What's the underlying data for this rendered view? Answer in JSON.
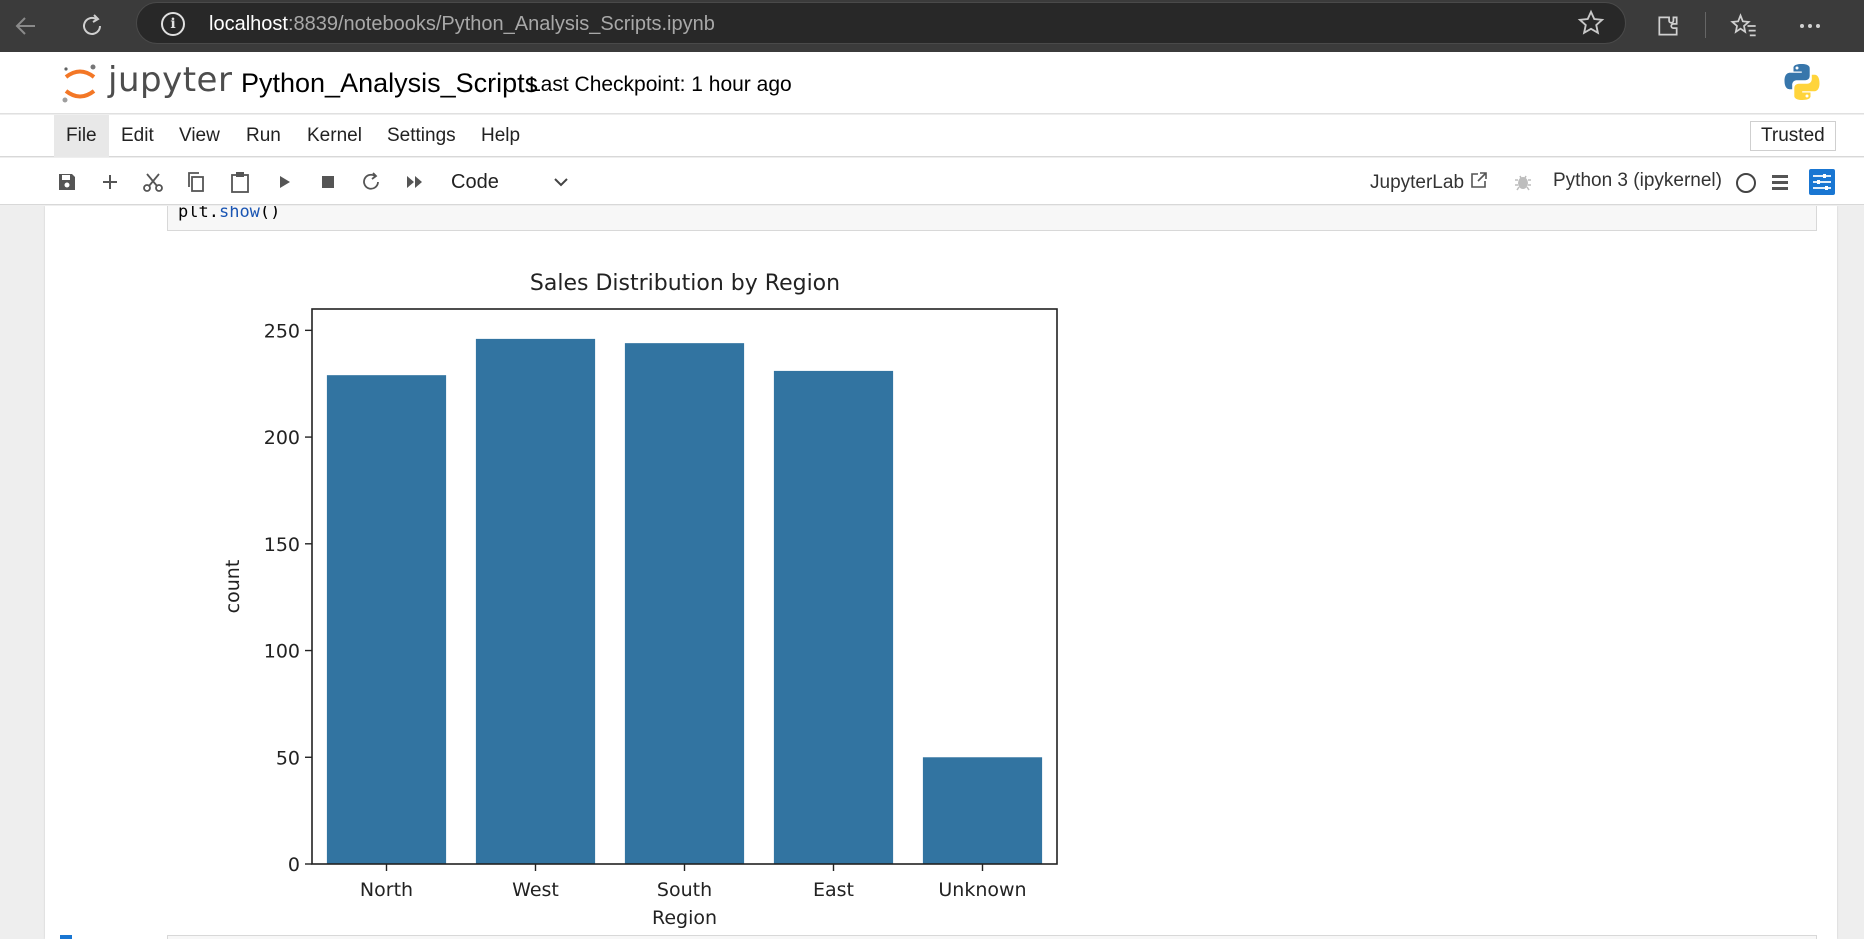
{
  "browser": {
    "url_host": "localhost",
    "url_rest": ":8839/notebooks/Python_Analysis_Scripts.ipynb"
  },
  "header": {
    "logo_text": "jupyter",
    "notebook_name": "Python_Analysis_Scripts",
    "checkpoint": "Last Checkpoint: 1 hour ago"
  },
  "menu": {
    "items": [
      "File",
      "Edit",
      "View",
      "Run",
      "Kernel",
      "Settings",
      "Help"
    ],
    "trusted": "Trusted"
  },
  "toolbar": {
    "cell_type": "Code",
    "jupyterlab_label": "JupyterLab",
    "kernel": "Python 3 (ipykernel)"
  },
  "code": {
    "obj": "plt",
    "dot": ".",
    "fn": "show",
    "parens": "()"
  },
  "colors": {
    "bar": "#3274a1",
    "accent": "#1976d2"
  },
  "chart_data": {
    "type": "bar",
    "title": "Sales Distribution by Region",
    "xlabel": "Region",
    "ylabel": "count",
    "categories": [
      "North",
      "West",
      "South",
      "East",
      "Unknown"
    ],
    "values": [
      229,
      246,
      244,
      231,
      50
    ],
    "ylim": [
      0,
      260
    ],
    "yticks": [
      0,
      50,
      100,
      150,
      200,
      250
    ],
    "grid": false
  }
}
